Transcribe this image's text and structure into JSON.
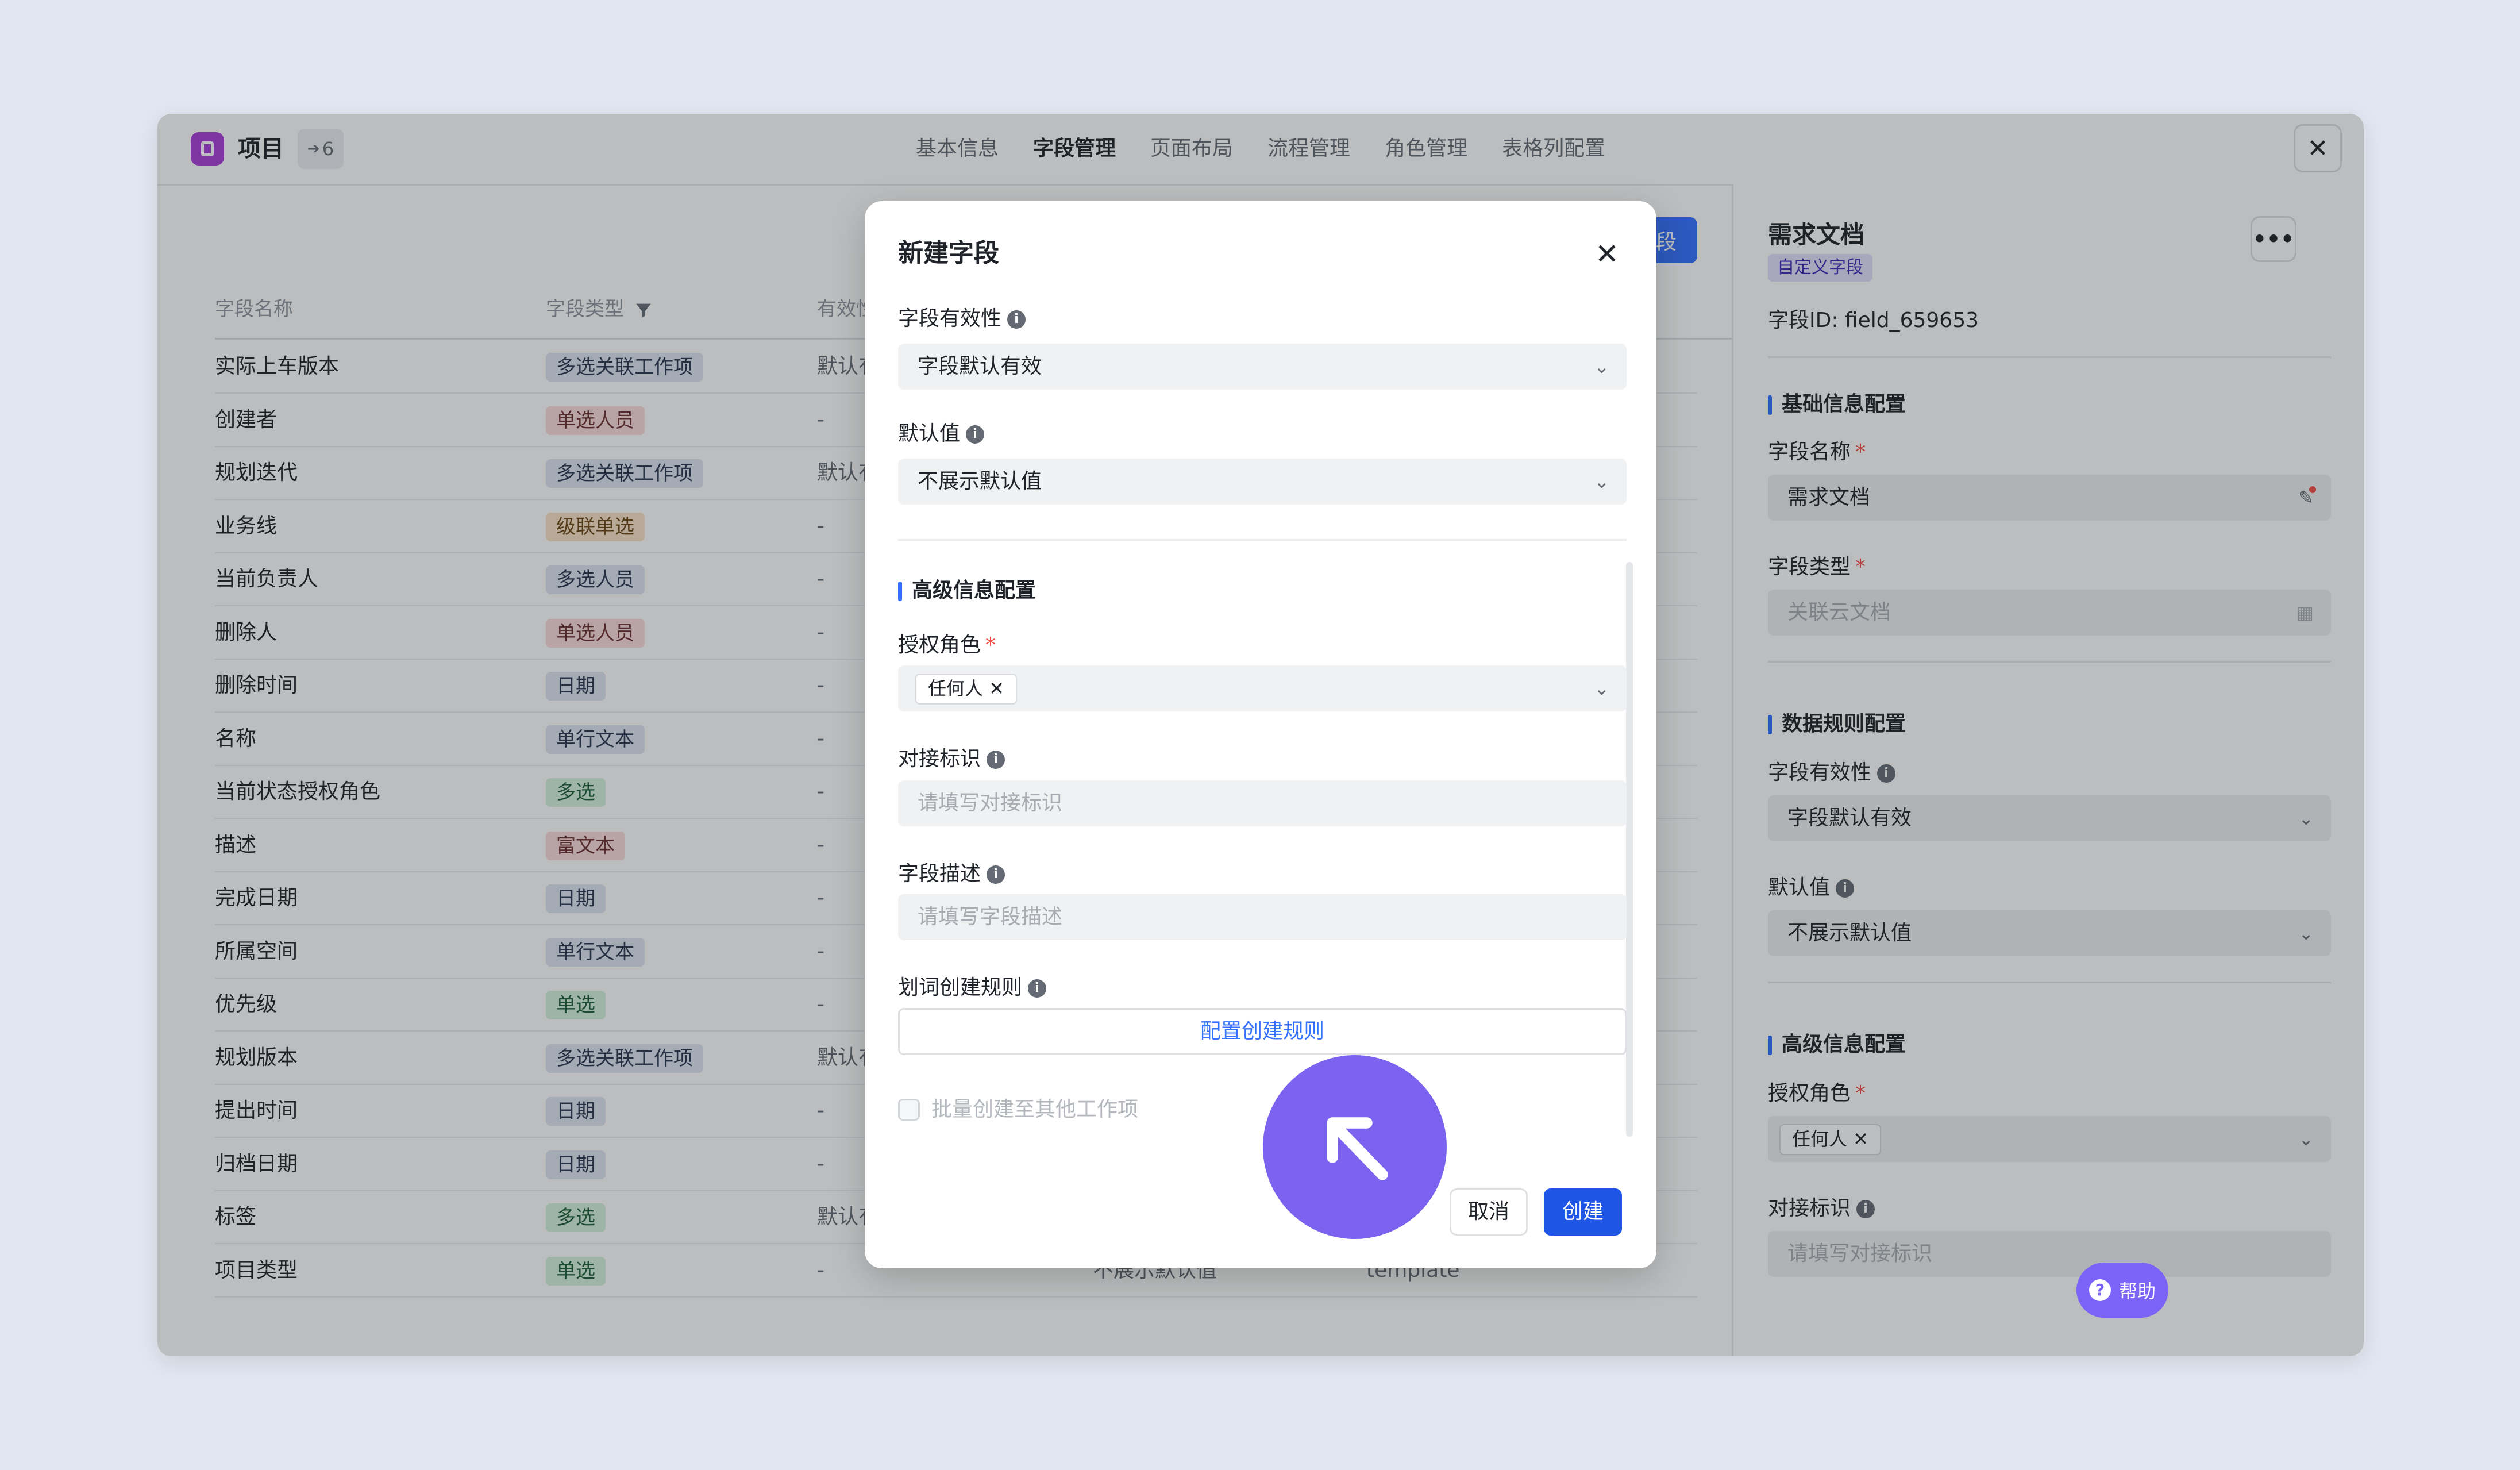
{
  "header": {
    "app_title": "项目",
    "count": "6",
    "tabs": [
      "基本信息",
      "字段管理",
      "页面布局",
      "流程管理",
      "角色管理",
      "表格列配置"
    ],
    "close_icon": "close-icon"
  },
  "table": {
    "new_button_label": "段",
    "columns": [
      "字段名称",
      "字段类型",
      "有效性"
    ],
    "rows": [
      {
        "name": "实际上车版本",
        "type": "多选关联工作项",
        "valid": "默认有"
      },
      {
        "name": "创建者",
        "type": "单选人员",
        "valid": "-"
      },
      {
        "name": "规划迭代",
        "type": "多选关联工作项",
        "valid": "默认有"
      },
      {
        "name": "业务线",
        "type": "级联单选",
        "valid": "-"
      },
      {
        "name": "当前负责人",
        "type": "多选人员",
        "valid": "-"
      },
      {
        "name": "删除人",
        "type": "单选人员",
        "valid": "-"
      },
      {
        "name": "删除时间",
        "type": "日期",
        "valid": "-"
      },
      {
        "name": "名称",
        "type": "单行文本",
        "valid": "-"
      },
      {
        "name": "当前状态授权角色",
        "type": "多选",
        "valid": "-"
      },
      {
        "name": "描述",
        "type": "富文本",
        "valid": "-"
      },
      {
        "name": "完成日期",
        "type": "日期",
        "valid": "-"
      },
      {
        "name": "所属空间",
        "type": "单行文本",
        "valid": "-"
      },
      {
        "name": "优先级",
        "type": "单选",
        "valid": "-"
      },
      {
        "name": "规划版本",
        "type": "多选关联工作项",
        "valid": "默认有"
      },
      {
        "name": "提出时间",
        "type": "日期",
        "valid": "-"
      },
      {
        "name": "归档日期",
        "type": "日期",
        "valid": "-"
      },
      {
        "name": "标签",
        "type": "多选",
        "valid": "默认有"
      },
      {
        "name": "项目类型",
        "type": "单选",
        "valid": "-"
      }
    ],
    "last_row_default": "不展示默认值",
    "last_row_key": "template"
  },
  "panel": {
    "title": "需求文档",
    "badge": "自定义字段",
    "field_id": "字段ID:  field_659653",
    "basic_section": "基础信息配置",
    "name_label": "字段名称",
    "name_value": "需求文档",
    "type_label": "字段类型",
    "type_value": "关联云文档",
    "data_section": "数据规则配置",
    "validity_label": "字段有效性",
    "validity_value": "字段默认有效",
    "default_label": "默认值",
    "default_value": "不展示默认值",
    "advanced_section": "高级信息配置",
    "roles_label": "授权角色",
    "roles_tag": "任何人",
    "ident_label": "对接标识",
    "ident_placeholder": "请填写对接标识",
    "help_label": "帮助"
  },
  "modal": {
    "title": "新建字段",
    "validity_label": "字段有效性",
    "validity_value": "字段默认有效",
    "default_label": "默认值",
    "default_value": "不展示默认值",
    "advanced_section": "高级信息配置",
    "roles_label": "授权角色",
    "roles_tag": "任何人",
    "ident_label": "对接标识",
    "ident_placeholder": "请填写对接标识",
    "desc_label": "字段描述",
    "desc_placeholder": "请填写字段描述",
    "rule_label": "划词创建规则",
    "rule_button": "配置创建规则",
    "batch_label": "批量创建至其他工作项",
    "cancel_label": "取消",
    "create_label": "创建"
  },
  "colors": {
    "accent": "#3370ff",
    "cursor": "#7b63f0",
    "logo": "#a93cd8"
  }
}
